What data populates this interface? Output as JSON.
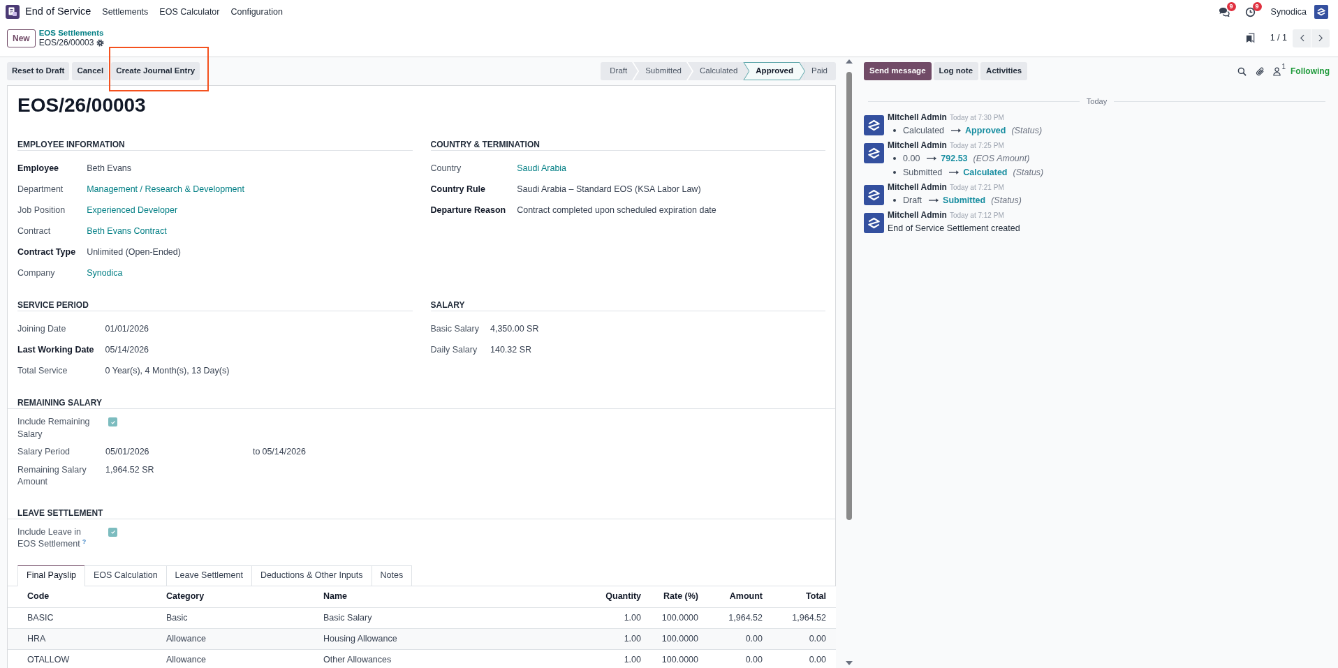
{
  "navbar": {
    "app_name": "End of Service",
    "menus": [
      {
        "label": "Settlements"
      },
      {
        "label": "EOS Calculator"
      },
      {
        "label": "Configuration"
      }
    ],
    "messages_count": "9",
    "activities_count": "9",
    "company": "Synodica"
  },
  "control_panel": {
    "new_button": "New",
    "breadcrumb": "EOS Settlements",
    "record_name": "EOS/26/00003",
    "pager": "1 / 1"
  },
  "actions": [
    {
      "label": "Reset to Draft",
      "highlighted": false
    },
    {
      "label": "Cancel",
      "highlighted": false
    },
    {
      "label": "Create Journal Entry",
      "highlighted": true
    }
  ],
  "statusbar": [
    {
      "label": "Draft",
      "selected": false
    },
    {
      "label": "Submitted",
      "selected": false
    },
    {
      "label": "Calculated",
      "selected": false
    },
    {
      "label": "Approved",
      "selected": true
    },
    {
      "label": "Paid",
      "selected": false
    }
  ],
  "sheet": {
    "title": "EOS/26/00003",
    "sections": [
      {
        "groups": [
          {
            "heading": "EMPLOYEE INFORMATION",
            "fields": [
              {
                "label": "Employee",
                "required": true,
                "kind": "text",
                "value": "Beth Evans"
              },
              {
                "label": "Department",
                "required": false,
                "kind": "link",
                "value": "Management / Research & Development"
              },
              {
                "label": "Job Position",
                "required": false,
                "kind": "link",
                "value": "Experienced Developer"
              },
              {
                "label": "Contract",
                "required": false,
                "kind": "link",
                "value": "Beth Evans Contract"
              },
              {
                "label": "Contract Type",
                "required": true,
                "kind": "text",
                "value": "Unlimited (Open-Ended)"
              },
              {
                "label": "Company",
                "required": false,
                "kind": "link",
                "value": "Synodica"
              }
            ]
          },
          {
            "heading": "COUNTRY & TERMINATION",
            "fields": [
              {
                "label": "Country",
                "required": false,
                "kind": "link",
                "value": "Saudi Arabia"
              },
              {
                "label": "Country Rule",
                "required": true,
                "kind": "text",
                "value": "Saudi Arabia – Standard EOS (KSA Labor Law)"
              },
              {
                "label": "Departure Reason",
                "required": true,
                "kind": "text",
                "value": "Contract completed upon scheduled expiration date"
              }
            ]
          }
        ]
      },
      {
        "groups": [
          {
            "heading": "SERVICE PERIOD",
            "fields": [
              {
                "label": "Joining Date",
                "required": false,
                "kind": "text",
                "value": "01/01/2026"
              },
              {
                "label": "Last Working Date",
                "required": true,
                "kind": "text",
                "value": "05/14/2026"
              },
              {
                "label": "Total Service",
                "required": false,
                "kind": "text",
                "value": "0 Year(s), 4 Month(s), 13 Day(s)"
              }
            ]
          },
          {
            "heading": "SALARY",
            "fields": [
              {
                "label": "Basic Salary",
                "required": false,
                "kind": "text",
                "value": "4,350.00 SR"
              },
              {
                "label": "Daily Salary",
                "required": false,
                "kind": "text",
                "value": "140.32 SR"
              }
            ]
          }
        ]
      },
      {
        "groups": [
          {
            "heading": "REMAINING SALARY",
            "fields": [
              {
                "label": "Include Remaining Salary",
                "required": false,
                "kind": "checkbox",
                "checked": true
              },
              {
                "label": "Salary Period",
                "required": false,
                "kind": "range",
                "value": "05/01/2026",
                "separator": "to",
                "value_end": "05/14/2026"
              },
              {
                "label": "Remaining Salary Amount",
                "required": false,
                "kind": "text",
                "value": "1,964.52 SR"
              }
            ]
          }
        ]
      },
      {
        "groups": [
          {
            "heading": "LEAVE SETTLEMENT",
            "fields": [
              {
                "label": "Include Leave in EOS Settlement",
                "required": false,
                "kind": "checkbox",
                "checked": true,
                "help": "?"
              }
            ]
          }
        ]
      }
    ],
    "tabs": [
      {
        "label": "Final Payslip",
        "selected": true
      },
      {
        "label": "EOS Calculation",
        "selected": false
      },
      {
        "label": "Leave Settlement",
        "selected": false
      },
      {
        "label": "Deductions & Other Inputs",
        "selected": false
      },
      {
        "label": "Notes",
        "selected": false
      }
    ],
    "table": {
      "columns": [
        {
          "label": "Code",
          "numeric": false
        },
        {
          "label": "Category",
          "numeric": false
        },
        {
          "label": "Name",
          "numeric": false
        },
        {
          "label": "Quantity",
          "numeric": true
        },
        {
          "label": "Rate (%)",
          "numeric": true
        },
        {
          "label": "Amount",
          "numeric": true
        },
        {
          "label": "Total",
          "numeric": true
        }
      ],
      "rows": [
        {
          "cells": [
            "BASIC",
            "Basic",
            "Basic Salary",
            "1.00",
            "100.0000",
            "1,964.52",
            "1,964.52"
          ]
        },
        {
          "cells": [
            "HRA",
            "Allowance",
            "Housing Allowance",
            "1.00",
            "100.0000",
            "0.00",
            "0.00"
          ]
        },
        {
          "cells": [
            "OTALLOW",
            "Allowance",
            "Other Allowances",
            "1.00",
            "100.0000",
            "0.00",
            "0.00"
          ]
        }
      ]
    }
  },
  "chatter": {
    "buttons": [
      {
        "label": "Send message",
        "kind": "primary"
      },
      {
        "label": "Log note",
        "kind": "secondary"
      },
      {
        "label": "Activities",
        "kind": "secondary"
      }
    ],
    "followers_count": "1",
    "follow_status": "Following",
    "date_separator": "Today",
    "messages": [
      {
        "author": "Mitchell Admin",
        "time": "Today at 7:30 PM",
        "changes": [
          {
            "old": "Calculated",
            "new": "Approved",
            "field": "(Status)"
          }
        ]
      },
      {
        "author": "Mitchell Admin",
        "time": "Today at 7:25 PM",
        "changes": [
          {
            "old": "0.00",
            "new": "792.53",
            "field": "(EOS Amount)"
          },
          {
            "old": "Submitted",
            "new": "Calculated",
            "field": "(Status)"
          }
        ]
      },
      {
        "author": "Mitchell Admin",
        "time": "Today at 7:21 PM",
        "changes": [
          {
            "old": "Draft",
            "new": "Submitted",
            "field": "(Status)"
          }
        ]
      },
      {
        "author": "Mitchell Admin",
        "time": "Today at 7:12 PM",
        "body": "End of Service Settlement created"
      }
    ]
  }
}
